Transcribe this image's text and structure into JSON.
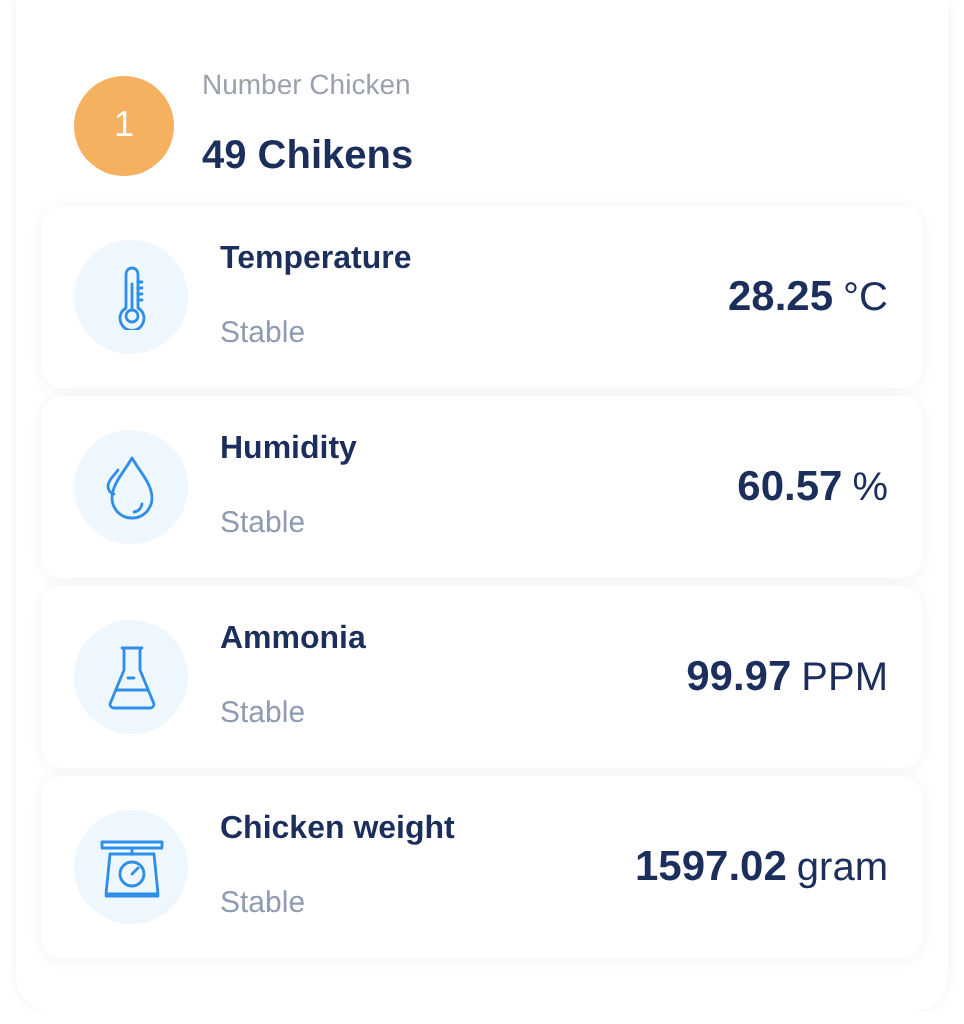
{
  "header": {
    "badge": "1",
    "label": "Number Chicken",
    "title": "49 Chikens"
  },
  "sensors": [
    {
      "kind": "thermometer",
      "name": "Temperature",
      "status": "Stable",
      "value": "28.25",
      "unit": "°C"
    },
    {
      "kind": "drop",
      "name": "Humidity",
      "status": "Stable",
      "value": "60.57",
      "unit": "%"
    },
    {
      "kind": "flask",
      "name": "Ammonia",
      "status": "Stable",
      "value": "99.97",
      "unit": "PPM"
    },
    {
      "kind": "scale",
      "name": "Chicken weight",
      "status": "Stable",
      "value": "1597.02",
      "unit": "gram"
    }
  ]
}
